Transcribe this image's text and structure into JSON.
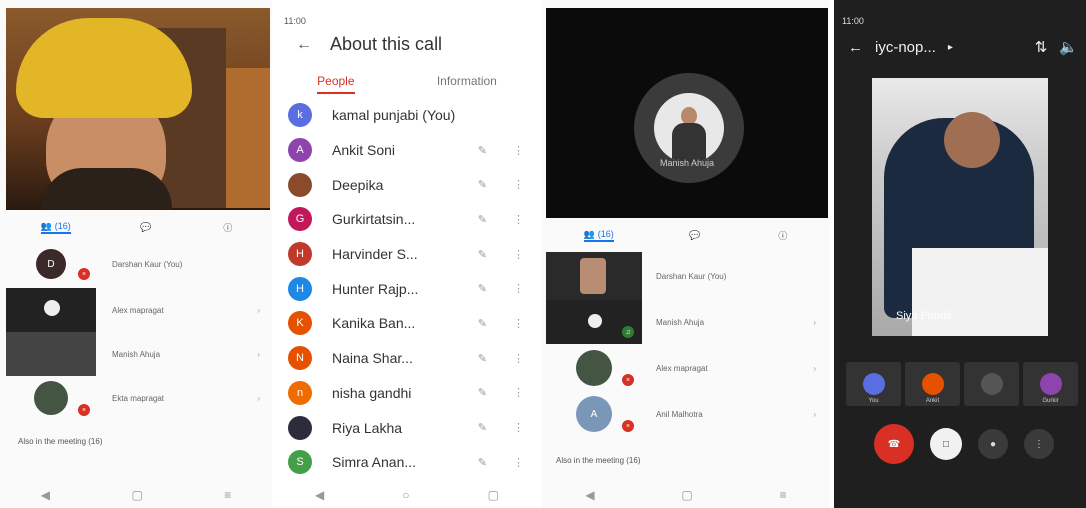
{
  "panel1": {
    "status": {
      "time": "",
      "right": ""
    },
    "tabs": [
      {
        "label": "(16)"
      },
      {
        "label": ""
      },
      {
        "label": ""
      }
    ],
    "rows": [
      {
        "label": "Darshan Kaur (You)",
        "badge": "D"
      },
      {
        "label": "Alex mapragat"
      },
      {
        "label": "Manish Ahuja"
      },
      {
        "label": "Ekta mapragat"
      }
    ],
    "footer": "Also in the meeting (16)"
  },
  "panel2": {
    "status": {
      "time": "11:00",
      "right": ""
    },
    "title": "About this call",
    "subtabs": [
      "People",
      "Information"
    ],
    "people": [
      {
        "name": "kamal punjabi (You)",
        "initial": "k",
        "color": "#5b6ee1"
      },
      {
        "name": "Ankit Soni",
        "initial": "A",
        "color": "#8e44ad"
      },
      {
        "name": "Deepika",
        "initial": "",
        "color": "#8a4b2d"
      },
      {
        "name": "Gurkirtatsin...",
        "initial": "G",
        "color": "#c2185b"
      },
      {
        "name": "Harvinder S...",
        "initial": "H",
        "color": "#c0392b"
      },
      {
        "name": "Hunter Rajp...",
        "initial": "H",
        "color": "#1e88e5"
      },
      {
        "name": "Kanika Ban...",
        "initial": "K",
        "color": "#e65100"
      },
      {
        "name": "Naina Shar...",
        "initial": "N",
        "color": "#e65100"
      },
      {
        "name": "nisha gandhi",
        "initial": "n",
        "color": "#ef6c00"
      },
      {
        "name": "Riya Lakha",
        "initial": "",
        "color": "#2c2c3c"
      },
      {
        "name": "Simra Anan...",
        "initial": "S",
        "color": "#43a047"
      }
    ]
  },
  "panel3": {
    "status": {
      "time": "",
      "right": ""
    },
    "video_label": "Manish Ahuja",
    "tabs": [
      {
        "label": "(16)"
      },
      {
        "label": ""
      },
      {
        "label": ""
      }
    ],
    "rows": [
      {
        "label": "Darshan Kaur (You)"
      },
      {
        "label": "Manish Ahuja"
      },
      {
        "label": "Alex mapragat"
      },
      {
        "label": "Anil Malhotra"
      }
    ],
    "footer": "Also in the meeting (16)"
  },
  "panel4": {
    "status": {
      "time": "11:00",
      "right": ""
    },
    "title": "iyc-nop...",
    "speaker_name": "Siya Pundir",
    "tiles": [
      {
        "label": "You",
        "color": "#5b6ee1"
      },
      {
        "label": "Ankit",
        "color": "#e65100"
      },
      {
        "label": "",
        "color": "#555555"
      },
      {
        "label": "Gurkir",
        "color": "#8e44ad"
      }
    ]
  }
}
